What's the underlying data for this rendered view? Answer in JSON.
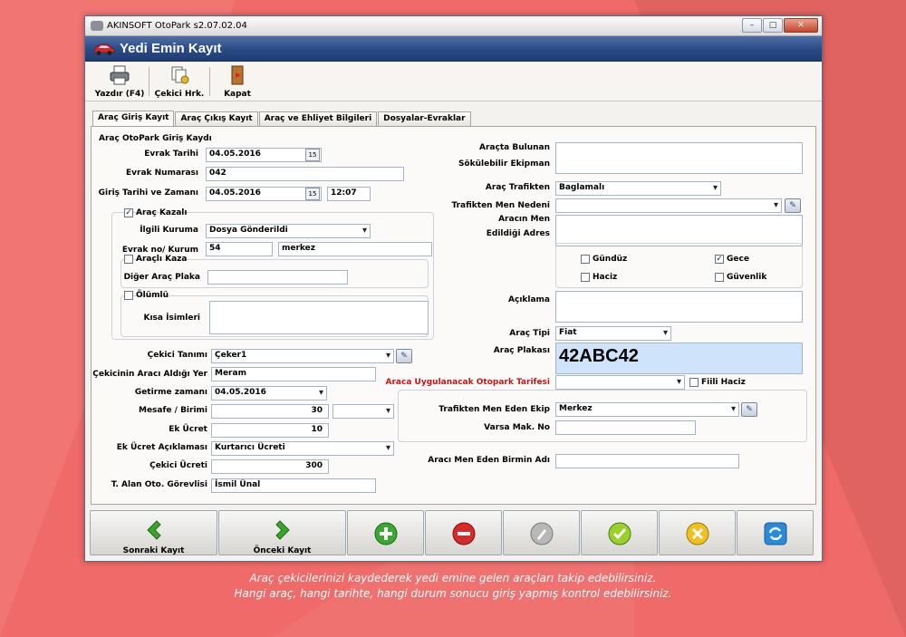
{
  "window": {
    "title": "AKINSOFT OtoPark s2.07.02.04",
    "minimize": "–",
    "maximize": "□",
    "close": "✕"
  },
  "header": {
    "title": "Yedi Emin Kayıt"
  },
  "toolbar": {
    "print": "Yazdır (F4)",
    "tow_moves": "Çekici Hrk.",
    "close": "Kapat"
  },
  "tabs": [
    "Araç Giriş Kayıt",
    "Araç Çıkış Kayıt",
    "Araç ve Ehliyet Bilgileri",
    "Dosyalar-Evraklar"
  ],
  "form": {
    "section_title": "Araç OtoPark Giriş Kaydı",
    "evrak_tarihi_label": "Evrak Tarihi",
    "evrak_tarihi": "04.05.2016",
    "evrak_no_label": "Evrak Numarası",
    "evrak_no": "042",
    "giris_label": "Giriş Tarihi ve Zamanı",
    "giris_tarihi": "04.05.2016",
    "giris_saati": "12:07",
    "cal_icon": "15",
    "arac_kazali_label": "Araç Kazalı",
    "arac_kazali_checked": "✓",
    "ilgili_kuruma_label": "İlgili Kuruma",
    "ilgili_kuruma": "Dosya Gönderildi",
    "evrak_kurum_label": "Evrak no/ Kurum",
    "evrak_kurum_no": "54",
    "evrak_kurum": "merkez",
    "aracli_kaza_label": "Araçlı Kaza",
    "diger_plaka_label": "Diğer Araç Plaka",
    "olumlu_label": "Ölümlü",
    "kisa_isimleri_label": "Kısa İsimleri",
    "cekici_tanimi_label": "Çekici Tanımı",
    "cekici_tanimi": "Çeker1",
    "cekicinin_yer_label": "Çekicinin Aracı Aldığı Yer",
    "cekicinin_yer": "Meram",
    "getirme_label": "Getirme zamanı",
    "getirme": "04.05.2016",
    "mesafe_label": "Mesafe / Birimi",
    "mesafe": "30",
    "ek_ucret_label": "Ek Ücret",
    "ek_ucret": "10",
    "ek_ucret_aciklama_label": "Ek Ücret Açıklaması",
    "ek_ucret_aciklama": "Kurtarıcı Ücreti",
    "cekici_ucreti_label": "Çekici Ücreti",
    "cekici_ucreti": "300",
    "gorevli_label": "T. Alan Oto. Görevlisi",
    "gorevli": "İsmil Ünal",
    "ekipman_label1": "Araçta Bulunan",
    "ekipman_label2": "Sökülebilir Ekipman",
    "arac_trafikten_label": "Araç Trafikten",
    "arac_trafikten": "Baglamalı",
    "men_nedeni_label": "Trafikten Men Nedeni",
    "men_adres_label1": "Aracın Men",
    "men_adres_label2": "Edildiği Adres",
    "gunduz_label": "Gündüz",
    "gece_label": "Gece",
    "gece_checked": "✓",
    "haciz_label": "Haciz",
    "guvenlik_label": "Güvenlik",
    "aciklama_label": "Açıklama",
    "arac_tipi_label": "Araç Tipi",
    "arac_tipi": "Fiat",
    "plaka_label": "Araç Plakası",
    "plaka": "42ABC42",
    "tarife_label": "Araca Uygulanacak Otopark Tarifesi",
    "fiili_haciz_label": "Fiili Haciz",
    "men_eden_ekip_label": "Trafikten Men Eden Ekip",
    "men_eden_ekip": "Merkez",
    "varsa_mak_label": "Varsa Mak. No",
    "birim_adi_label": "Aracı Men Eden Birmin Adı"
  },
  "bottom": {
    "next": "Sonraki Kayıt",
    "prev": "Önceki Kayıt"
  },
  "colors": {
    "background": "#ef6a68",
    "header": "#2a4a86",
    "tarife_label": "#c81414",
    "plaka_bg": "#cfe4fb"
  },
  "caption": {
    "line1": "Araç çekicilerinizi kaydederek yedi emine gelen araçları takip edebilirsiniz.",
    "line2": "Hangi araç, hangi tarihte, hangi durum sonucu giriş yapmış kontrol edebilirsiniz."
  }
}
